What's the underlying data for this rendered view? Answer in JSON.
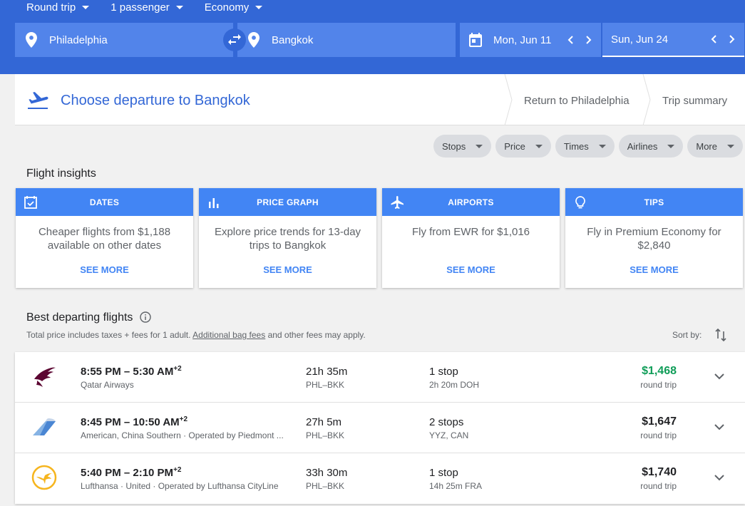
{
  "search": {
    "trip_type": "Round trip",
    "passengers": "1 passenger",
    "cabin": "Economy",
    "origin": "Philadelphia",
    "destination": "Bangkok",
    "depart_date": "Mon, Jun 11",
    "return_date": "Sun, Jun 24"
  },
  "steps": {
    "current": "Choose departure to Bangkok",
    "return": "Return to Philadelphia",
    "summary": "Trip summary"
  },
  "filters": [
    "Stops",
    "Price",
    "Times",
    "Airlines",
    "More"
  ],
  "insights": {
    "title": "Flight insights",
    "cards": [
      {
        "heading": "DATES",
        "icon": "calendar-check-icon",
        "text": "Cheaper flights from $1,188 available on other dates",
        "action": "SEE MORE"
      },
      {
        "heading": "PRICE GRAPH",
        "icon": "bar-chart-icon",
        "text": "Explore price trends for 13-day trips to Bangkok",
        "action": "SEE MORE"
      },
      {
        "heading": "AIRPORTS",
        "icon": "airplane-icon",
        "text": "Fly from EWR for $1,016",
        "action": "SEE MORE"
      },
      {
        "heading": "TIPS",
        "icon": "lightbulb-icon",
        "text": "Fly in Premium Economy for $2,840",
        "action": "SEE MORE"
      }
    ]
  },
  "results": {
    "title": "Best departing flights",
    "fees_prefix": "Total price includes taxes + fees for 1 adult.",
    "fees_link": "Additional bag fees",
    "fees_suffix": "and other fees may apply.",
    "sort_label": "Sort by:",
    "flights": [
      {
        "times": "8:55 PM – 5:30 AM",
        "day_offset": "+2",
        "airline": "Qatar Airways",
        "duration": "21h 35m",
        "route": "PHL–BKK",
        "stops": "1 stop",
        "stop_detail": "2h 20m DOH",
        "price": "$1,468",
        "price_type": "round trip",
        "logo": "qatar-logo",
        "best": true
      },
      {
        "times": "8:45 PM – 10:50 AM",
        "day_offset": "+2",
        "airline": "American, China Southern · Operated by Piedmont ...",
        "duration": "27h 5m",
        "route": "PHL–BKK",
        "stops": "2 stops",
        "stop_detail": "YYZ, CAN",
        "price": "$1,647",
        "price_type": "round trip",
        "logo": "american-logo",
        "best": false
      },
      {
        "times": "5:40 PM – 2:10 PM",
        "day_offset": "+2",
        "airline": "Lufthansa · United · Operated by Lufthansa CityLine",
        "duration": "33h 30m",
        "route": "PHL–BKK",
        "stops": "1 stop",
        "stop_detail": "14h 25m FRA",
        "price": "$1,740",
        "price_type": "round trip",
        "logo": "lufthansa-logo",
        "best": false
      }
    ]
  },
  "colors": {
    "header": "#3367d6",
    "field": "#5284ea",
    "card_header": "#4285f4",
    "best_price": "#0f9d58"
  }
}
